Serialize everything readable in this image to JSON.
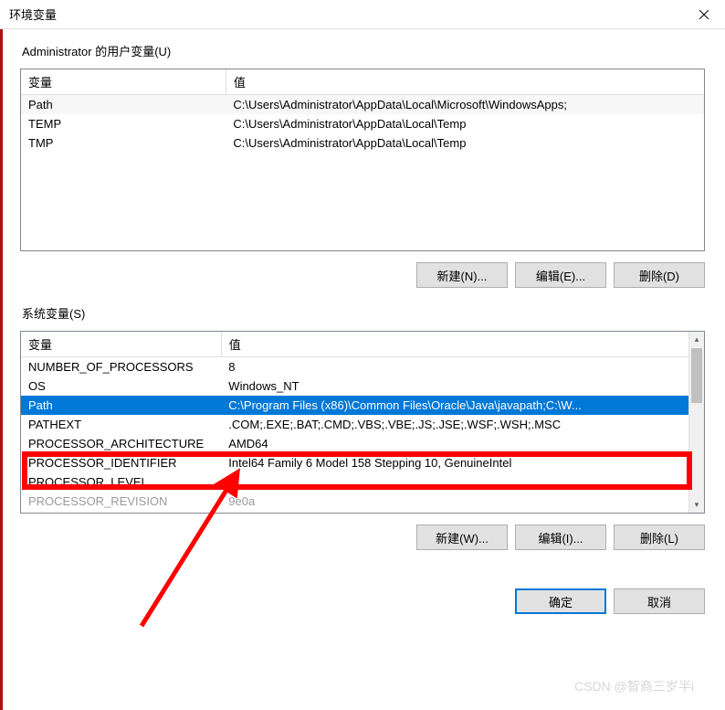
{
  "window": {
    "title": "环境变量"
  },
  "user_vars": {
    "group_label": "Administrator 的用户变量(U)",
    "headers": {
      "variable": "变量",
      "value": "值"
    },
    "rows": [
      {
        "variable": "Path",
        "value": "C:\\Users\\Administrator\\AppData\\Local\\Microsoft\\WindowsApps;"
      },
      {
        "variable": "TEMP",
        "value": "C:\\Users\\Administrator\\AppData\\Local\\Temp"
      },
      {
        "variable": "TMP",
        "value": "C:\\Users\\Administrator\\AppData\\Local\\Temp"
      }
    ],
    "buttons": {
      "new": "新建(N)...",
      "edit": "编辑(E)...",
      "delete": "删除(D)"
    }
  },
  "system_vars": {
    "group_label": "系统变量(S)",
    "headers": {
      "variable": "变量",
      "value": "值"
    },
    "rows": [
      {
        "variable": "NUMBER_OF_PROCESSORS",
        "value": "8"
      },
      {
        "variable": "OS",
        "value": "Windows_NT"
      },
      {
        "variable": "Path",
        "value": "C:\\Program Files (x86)\\Common Files\\Oracle\\Java\\javapath;C:\\W...",
        "selected": true
      },
      {
        "variable": "PATHEXT",
        "value": ".COM;.EXE;.BAT;.CMD;.VBS;.VBE;.JS;.JSE;.WSF;.WSH;.MSC"
      },
      {
        "variable": "PROCESSOR_ARCHITECTURE",
        "value": "AMD64"
      },
      {
        "variable": "PROCESSOR_IDENTIFIER",
        "value": "Intel64 Family 6 Model 158 Stepping 10, GenuineIntel"
      },
      {
        "variable": "PROCESSOR_LEVEL",
        "value": "6"
      },
      {
        "variable": "PROCESSOR_REVISION",
        "value": "9e0a"
      }
    ],
    "buttons": {
      "new": "新建(W)...",
      "edit": "编辑(I)...",
      "delete": "删除(L)"
    }
  },
  "footer": {
    "ok": "确定",
    "cancel": "取消"
  },
  "watermark": "CSDN @智商三岁半i"
}
